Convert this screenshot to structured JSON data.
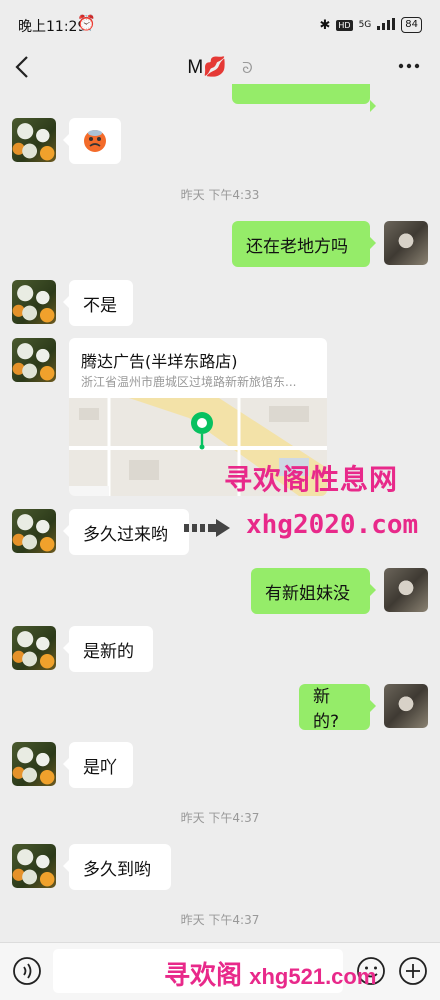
{
  "status_bar": {
    "time": "晚上11:29",
    "network": "5G",
    "battery": "84"
  },
  "header": {
    "title": "M💋"
  },
  "messages": {
    "m2_text": "还在老地方吗",
    "m3_text": "不是",
    "m5_text": "多久过来哟",
    "m6_text": "有新姐妹没",
    "m7_text": "是新的",
    "m8_text": "新的?",
    "m9_text": "是吖",
    "m10_text": "多久到哟"
  },
  "timestamps": {
    "t1": "昨天 下午4:33",
    "t2": "昨天 下午4:37",
    "t3": "昨天 下午4:37"
  },
  "location": {
    "name": "腾达广告(半垟东路店)",
    "address": "浙江省温州市鹿城区过境路新新旅馆东..."
  },
  "watermarks": {
    "w1": "寻欢阁性息网",
    "w2": "xhg2020.com",
    "w3": "寻欢阁",
    "w4": "xhg521.com"
  },
  "colors": {
    "sent_bubble": "#95ec69",
    "received_bubble": "#ffffff",
    "background": "#ededed",
    "map_pin": "#07c160",
    "watermark": "#e8298a"
  },
  "icons": {
    "back": "chevron-left-icon",
    "more": "more-icon",
    "voice": "voice-icon",
    "emoji": "emoji-icon",
    "plus": "plus-icon"
  }
}
